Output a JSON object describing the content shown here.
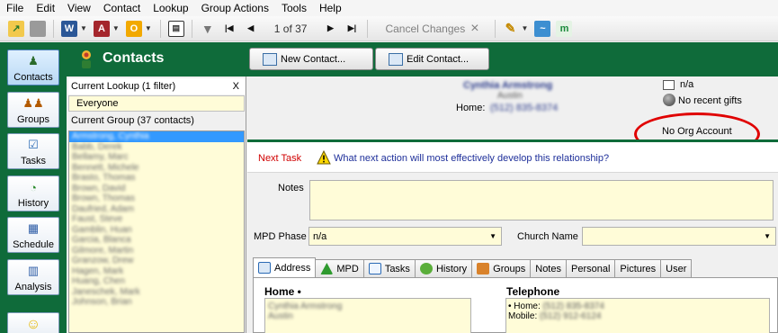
{
  "menu": [
    "File",
    "Edit",
    "View",
    "Contact",
    "Lookup",
    "Group Actions",
    "Tools",
    "Help"
  ],
  "toolbar": {
    "record_position": "1 of 37",
    "cancel_changes": "Cancel Changes",
    "cancel_icon": "×",
    "first_icon": "|◀",
    "prev_icon": "◀",
    "next_icon": "▶",
    "last_icon": "▶|"
  },
  "sidebar": {
    "items": [
      {
        "label": "Contacts",
        "icon": "person-icon"
      },
      {
        "label": "Groups",
        "icon": "group-icon"
      },
      {
        "label": "Tasks",
        "icon": "checklist-icon"
      },
      {
        "label": "History",
        "icon": "history-icon"
      },
      {
        "label": "Schedule",
        "icon": "calendar-icon"
      },
      {
        "label": "Analysis",
        "icon": "chart-icon"
      }
    ]
  },
  "header": {
    "title": "Contacts",
    "new_contact": "New Contact...",
    "edit_contact": "Edit Contact..."
  },
  "lookup": {
    "current_lookup": "Current Lookup (1 filter)",
    "close": "X",
    "everyone": "Everyone",
    "current_group": "Current Group (37 contacts)",
    "contacts": [
      "Armstrong, Cynthia",
      "Babb, Derek",
      "Bellamy, Marc",
      "Bennett, Michele",
      "Brasto, Thomas",
      "Brown, David",
      "Brown, Thomas",
      "Daufried, Adam",
      "Faust, Steve",
      "Gamblin, Huan",
      "Garcia, Blanca",
      "Gilmore, Martin",
      "Granzow, Drew",
      "Hagen, Mark",
      "Huang, Chen",
      "Janeschek, Mark",
      "Johnson, Brian"
    ]
  },
  "summary": {
    "name": "Cynthia Armstrong",
    "city": "Austin",
    "home_label": "Home:",
    "home_phone": "(512) 835-8374",
    "mpd_status": "n/a",
    "gifts": "No recent gifts",
    "org_account": "No Org Account"
  },
  "next_task": {
    "label": "Next Task",
    "prompt": "What next action will most effectively develop this relationship?"
  },
  "fields": {
    "notes_label": "Notes",
    "mpd_phase_label": "MPD Phase",
    "mpd_phase_value": "n/a",
    "church_name_label": "Church Name",
    "church_name_value": ""
  },
  "tabs": [
    "Address",
    "MPD",
    "Tasks",
    "History",
    "Groups",
    "Notes",
    "Personal",
    "Pictures",
    "User"
  ],
  "address": {
    "heading": "Home •",
    "line1": "Cynthia Armstrong",
    "line2": "Austin"
  },
  "telephone": {
    "heading": "Telephone",
    "home_label": "• Home:",
    "home_value": "(512) 835-8374",
    "mobile_label": "Mobile:",
    "mobile_value": "(512) 912-6124"
  },
  "colors": {
    "brand_green": "#0f6b3a",
    "field_yellow": "#fffcd8",
    "highlight_red": "#e00000",
    "link_blue": "#1e2f9a"
  }
}
